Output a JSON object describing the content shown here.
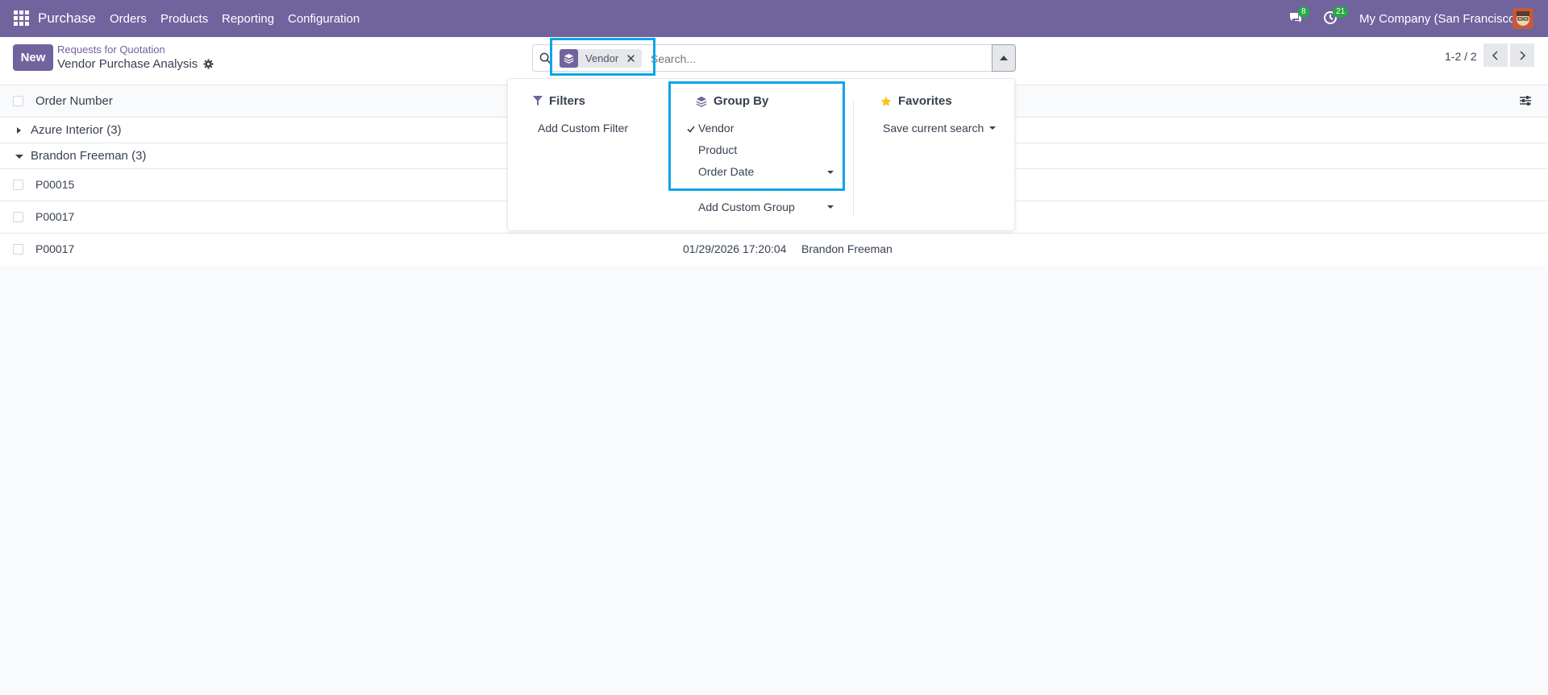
{
  "navbar": {
    "app_name": "Purchase",
    "menu": [
      "Orders",
      "Products",
      "Reporting",
      "Configuration"
    ],
    "messages_count": "8",
    "activities_count": "21",
    "company": "My Company (San Francisco)"
  },
  "control": {
    "new_label": "New",
    "breadcrumb": "Requests for Quotation",
    "title": "Vendor Purchase Analysis",
    "pager": "1-2 / 2"
  },
  "search": {
    "facet": "Vendor",
    "placeholder": "Search..."
  },
  "list": {
    "column": "Order Number",
    "groups": [
      {
        "label": "Azure Interior (3)"
      },
      {
        "label": "Brandon Freeman (3)"
      }
    ],
    "rows": [
      {
        "number": "P00015",
        "date": "",
        "vendor": ""
      },
      {
        "number": "P00017",
        "date": "",
        "vendor": ""
      },
      {
        "number": "P00017",
        "date": "01/29/2026 17:20:04",
        "vendor": "Brandon Freeman"
      }
    ]
  },
  "dropdown": {
    "filters": {
      "title": "Filters",
      "items": [
        "Add Custom Filter"
      ]
    },
    "group_by": {
      "title": "Group By",
      "items": [
        "Vendor",
        "Product",
        "Order Date"
      ],
      "custom": "Add Custom Group"
    },
    "favorites": {
      "title": "Favorites",
      "items": [
        "Save current search"
      ]
    }
  },
  "colors": {
    "brand": "#71639e",
    "highlight": "#0ea5e9",
    "badge": "#28a745",
    "star": "#f5c518"
  }
}
